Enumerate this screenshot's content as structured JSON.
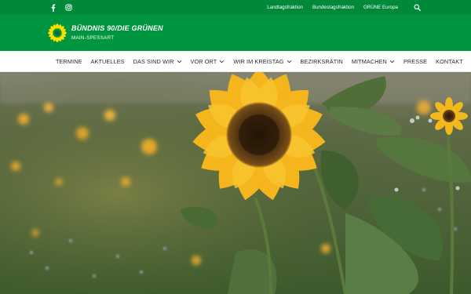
{
  "header": {
    "social": [
      {
        "name": "facebook-icon",
        "glyph": "f"
      },
      {
        "name": "instagram-icon",
        "glyph": "instagram"
      }
    ],
    "links": [
      "Landtagsfraktion",
      "Bundestagsfraktion",
      "GRÜNE Europa"
    ],
    "search_icon": "search-icon"
  },
  "brand": {
    "title": "BÜNDNIS 90/DIE GRÜNEN",
    "subtitle": "MAIN-SPESSART",
    "logo": "sunflower-logo"
  },
  "nav": {
    "items": [
      {
        "label": "TERMINE",
        "dropdown": false
      },
      {
        "label": "AKTUELLES",
        "dropdown": false
      },
      {
        "label": "DAS SIND WIR",
        "dropdown": true
      },
      {
        "label": "VOR ORT",
        "dropdown": true
      },
      {
        "label": "WIR IM KREISTAG",
        "dropdown": true
      },
      {
        "label": "BEZIRKSRÄTIN",
        "dropdown": false
      },
      {
        "label": "MITMACHEN",
        "dropdown": true
      },
      {
        "label": "PRESSE",
        "dropdown": false
      },
      {
        "label": "KONTAKT",
        "dropdown": false
      }
    ]
  },
  "hero": {
    "image": "sunflower-field-photo"
  },
  "colors": {
    "topbar": "#008939",
    "brandbar": "#00963f",
    "sunflower": "#f5b51c"
  }
}
